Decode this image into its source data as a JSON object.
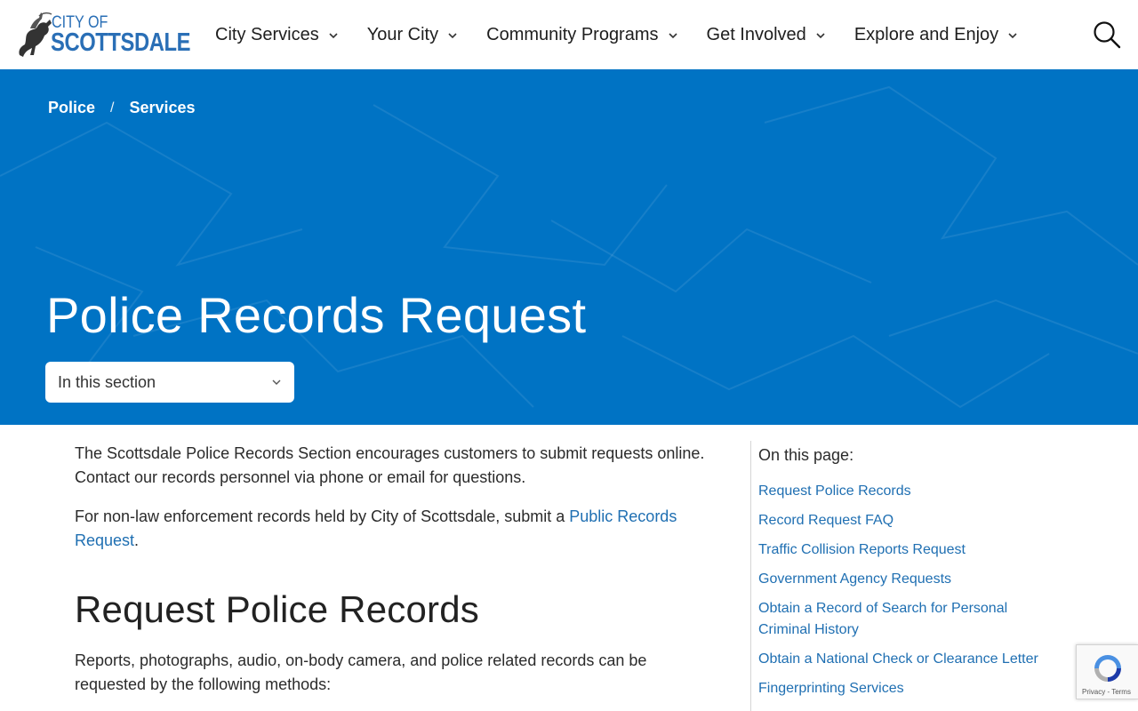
{
  "logo": {
    "city_of": "CITY OF",
    "name": "SCOTTSDALE"
  },
  "nav": {
    "items": [
      {
        "label": "City Services"
      },
      {
        "label": "Your City"
      },
      {
        "label": "Community Programs"
      },
      {
        "label": "Get Involved"
      },
      {
        "label": "Explore and Enjoy"
      }
    ]
  },
  "breadcrumb": {
    "items": [
      "Police",
      "Services"
    ],
    "separator": "/"
  },
  "hero": {
    "title": "Police Records Request",
    "bg_color": "#0073c4"
  },
  "section_select": {
    "value": "In this section"
  },
  "content": {
    "p1": "The Scottsdale Police Records Section encourages customers to submit requests online. Contact our records personnel via phone or email for questions.",
    "p2_before": "For non-law enforcement records held by City of Scottsdale, submit a ",
    "p2_link": "Public Records Request",
    "p2_after": ".",
    "h2": "Request Police Records",
    "p3": "Reports, photographs, audio, on-body camera, and police related records can be requested by the following methods:"
  },
  "sidebar": {
    "title": "On this page:",
    "links": [
      "Request Police Records",
      "Record Request FAQ",
      "Traffic Collision Reports Request",
      "Government Agency Requests",
      "Obtain a Record of Search for Personal Criminal History",
      "Obtain a National Check or Clearance Letter",
      "Fingerprinting Services"
    ]
  },
  "recaptcha": {
    "terms": "Privacy - Terms"
  },
  "colors": {
    "accent": "#0073c4",
    "link": "#1f6fb2",
    "logo": "#2a6fb6"
  }
}
